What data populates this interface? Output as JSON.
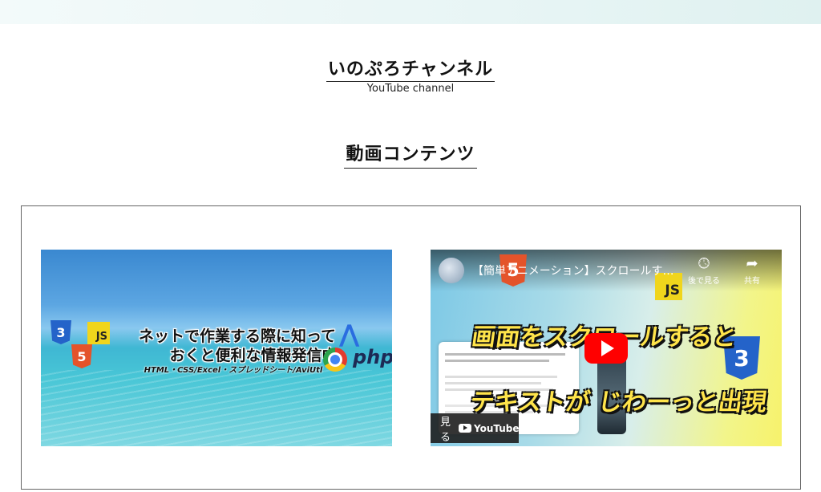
{
  "header": {
    "channel_title": "いのぷろチャンネル",
    "channel_subtitle": "YouTube channel",
    "section_title": "動画コンテンツ"
  },
  "banner": {
    "line1": "ネットで作業する際に知って",
    "line2": "おくと便利な情報発信中",
    "line3": "HTML・CSS/Excel・スプレッドシート/AviUtl",
    "badge_css": "3",
    "badge_html": "5",
    "badge_js": "JS",
    "badge_php": "php"
  },
  "video": {
    "title": "【簡単アニメーション】スクロールす…",
    "watch_later_label": "後で見る",
    "share_label": "共有",
    "caption_line1": "画面をスクロールすると",
    "caption_line2": "テキストが じわーっと出現",
    "watch_on_label": "見る",
    "youtube_label": "YouTube",
    "badge_html": "5",
    "badge_js": "JS",
    "badge_css": "3"
  },
  "icons": {
    "watch_later": "clock-icon",
    "share": "share-icon",
    "play": "play-icon"
  },
  "colors": {
    "play_button": "#ff0000",
    "caption_text": "#ffe44a"
  }
}
